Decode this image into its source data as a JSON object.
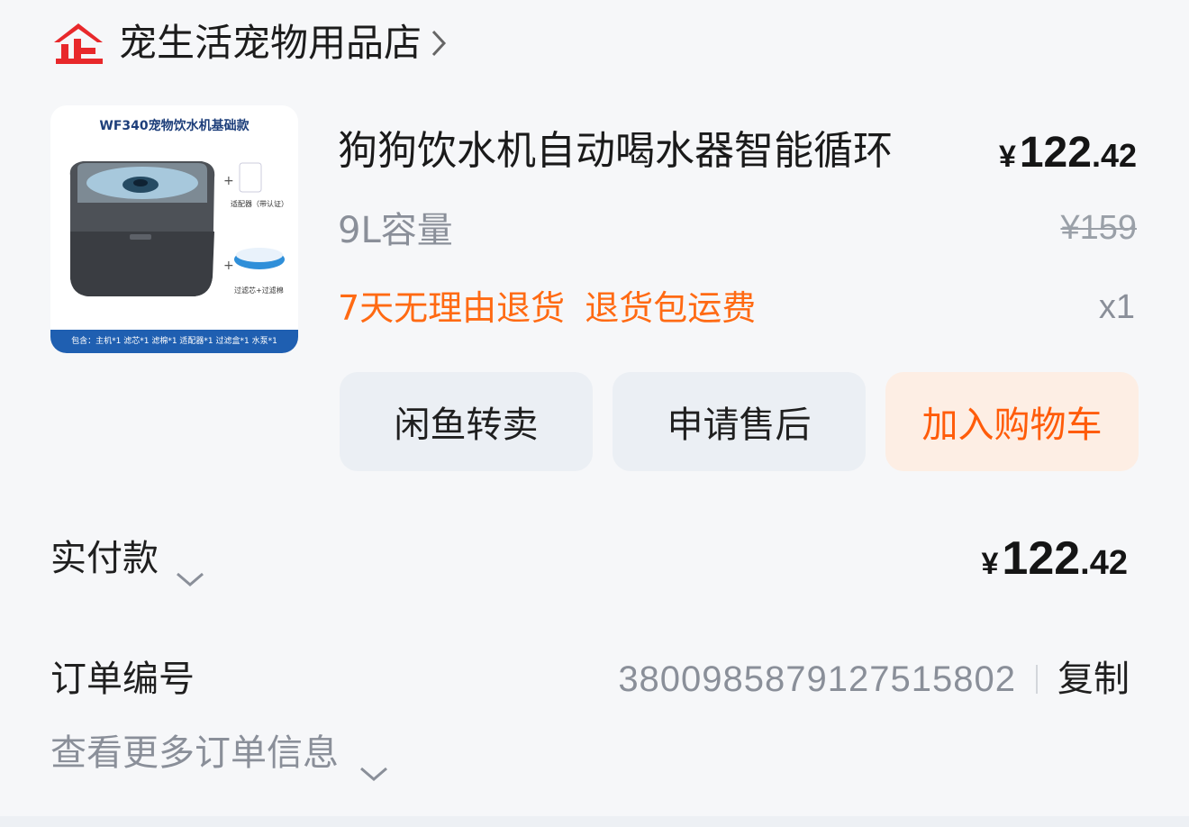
{
  "store": {
    "name": "宠生活宠物用品店"
  },
  "product": {
    "image": {
      "title": "WF340宠物饮水机基础款",
      "accessory_1": "适配器（带认证）",
      "accessory_2": "过滤芯+过滤棉",
      "footer": "包含：主机*1 滤芯*1  滤棉*1  适配器*1  过滤盒*1  水泵*1"
    },
    "title": "狗狗饮水机自动喝水器智能循环",
    "price": {
      "currency": "¥",
      "integer": "122",
      "decimal": ".42"
    },
    "spec": "9L容量",
    "original_price": "¥159",
    "tags": [
      "7天无理由退货",
      "退货包运费"
    ],
    "quantity": "x1"
  },
  "actions": {
    "resell": "闲鱼转卖",
    "after_sale": "申请售后",
    "add_to_cart": "加入购物车"
  },
  "payment": {
    "label": "实付款",
    "currency": "¥",
    "integer": "122",
    "decimal": ".42"
  },
  "order": {
    "label": "订单编号",
    "number": "3800985879127515802",
    "copy": "复制",
    "more": "查看更多订单信息"
  },
  "colors": {
    "accent_orange": "#ff6a13",
    "logo_red": "#e8282b",
    "muted_text": "#8a8f99"
  }
}
